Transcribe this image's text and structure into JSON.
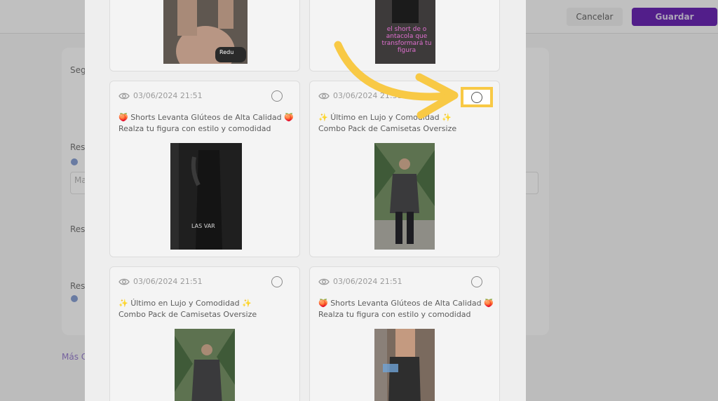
{
  "background": {
    "cancel_label": "Cancelar",
    "save_label": "Guardar",
    "labels": [
      "Seg",
      "Res",
      "Ma",
      "Res",
      "Res"
    ],
    "more_link": "Más C"
  },
  "posts": [
    {
      "date": "03/06/2024 21:51",
      "line1": "🍑 Shorts Levanta Glúteos de Alta Calidad 🍑",
      "line2": "Realza tu figura con estilo y comodidad",
      "thumb_text": "LAS VAR"
    },
    {
      "date": "03/06/2024 21:51",
      "line1": "✨ Último en Lujo y Comodidad ✨",
      "line2": "Combo Pack de Camisetas Oversize"
    },
    {
      "date": "03/06/2024 21:51",
      "line1": "✨ Último en Lujo y Comodidad ✨",
      "line2": "Combo Pack de Camisetas Oversize"
    },
    {
      "date": "03/06/2024 21:51",
      "line1": "🍑 Shorts Levanta Glúteos de Alta Calidad 🍑",
      "line2": "Realza tu figura con estilo y comodidad"
    }
  ],
  "top_cards": {
    "left_logo": "Redu",
    "right_text": "el short de o antacola que transformará tu figura"
  },
  "colors": {
    "accent": "#5a12a8",
    "highlight": "#f8c945"
  },
  "icons": {
    "views": "eye-icon",
    "select": "radio-circle-icon"
  }
}
